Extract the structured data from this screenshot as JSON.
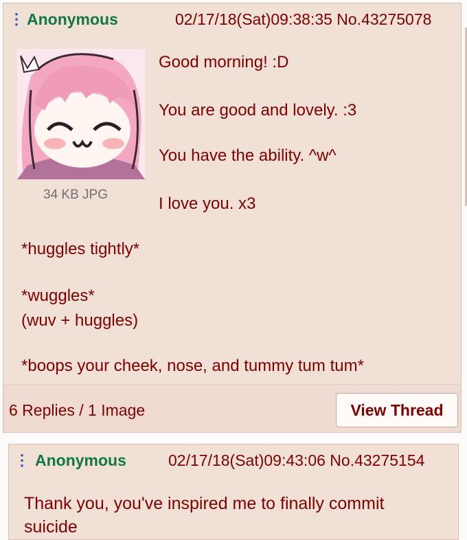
{
  "post1": {
    "name": "Anonymous",
    "meta": "02/17/18(Sat)09:38:35 No.43275078",
    "file_info": "34 KB JPG",
    "lines": [
      "Good morning! :D",
      "You are good and lovely. :3",
      "You have the ability. ^w^",
      "I love you. x3",
      "*huggles tightly*",
      "*wuggles*",
      "(wuv + huggles)",
      "*boops your cheek, nose, and tummy tum tum*"
    ],
    "replies": "6 Replies / 1 Image",
    "view_thread": "View Thread",
    "thumbnail_icon": "anime-girl-thumbnail"
  },
  "post2": {
    "name": "Anonymous",
    "meta": "02/17/18(Sat)09:43:06 No.43275154",
    "lines": [
      "Thank you, you've inspired me to finally commit",
      "suicide"
    ]
  },
  "menu_icon": "vertical-dots-icon",
  "colors": {
    "post_bg": "#f0e0d6",
    "name": "#117743",
    "text": "#800000",
    "menu": "#2d4fbe"
  }
}
